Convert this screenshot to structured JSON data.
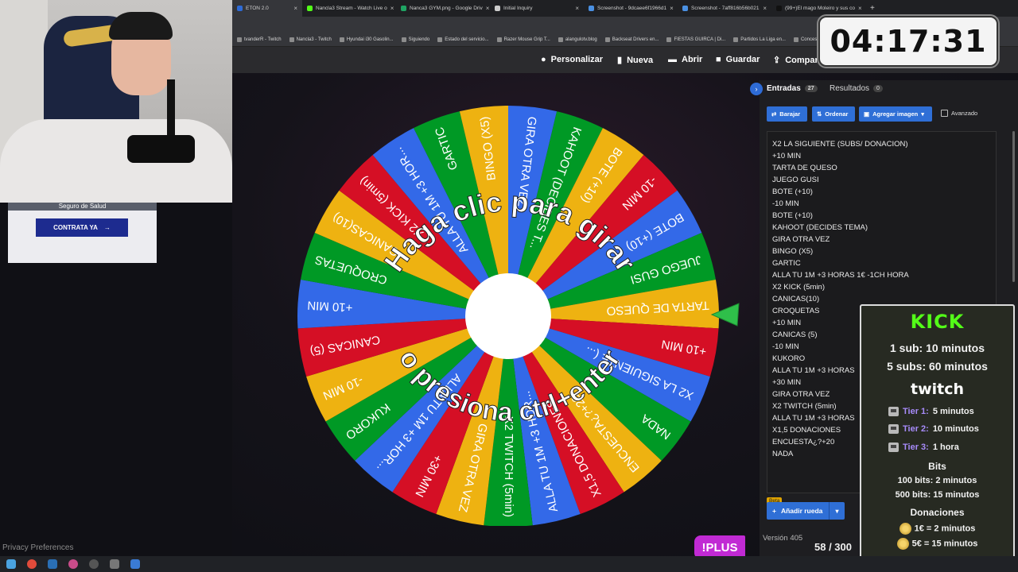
{
  "browser": {
    "tabs": [
      {
        "title": "ETON 2.0",
        "icon_color": "#2e6bd6",
        "active": true
      },
      {
        "title": "Nancla3 Stream - Watch Live o",
        "icon_color": "#53fc18",
        "active": false
      },
      {
        "title": "Nanca3 GYM.png - Google Driv",
        "icon_color": "#1fa463",
        "active": false
      },
      {
        "title": "Initial Inquiry",
        "icon_color": "#cccccc",
        "active": false
      },
      {
        "title": "Screenshot - 9dcaee6f1966d1",
        "icon_color": "#4a90e2",
        "active": false
      },
      {
        "title": "Screenshot - 7aff816b56b021",
        "icon_color": "#4a90e2",
        "active": false
      },
      {
        "title": "(99+)El mago Moleiro y sus co",
        "icon_color": "#111111",
        "active": false
      }
    ],
    "new_tab_symbol": "+",
    "bookmarks": [
      "tvanderR - Twitch",
      "Nancla3 - Twitch",
      "Hyundai i30 Gasolin...",
      "Siguiendo",
      "Estado del servicio...",
      "Razer Mouse Grip T...",
      "alangulotv.blog",
      "Backseat Drivers en...",
      "FIESTAS GUIRCA | Di...",
      "Partidos La Liga en...",
      "Concesion"
    ]
  },
  "left": {
    "ad_text": "Seguro de Salud",
    "ad_button": "CONTRATA YA",
    "ad_arrow": "→",
    "privacy": "Privacy Preferences"
  },
  "header": {
    "customize": "Personalizar",
    "new": "Nueva",
    "open": "Abrir",
    "save": "Guardar",
    "share": "Compar"
  },
  "wheel": {
    "segments": [
      "GIRA OTRA VEZ",
      "KAHOOT (DECIDES T...",
      "BOTE (+10)",
      "-10 MIN",
      "BOTE (+10)",
      "JUEGO GUSI",
      "TARTA DE QUESO",
      "+10 MIN",
      "X2 LA SIGUIENTE (...",
      "NADA",
      "ENCUESTA¿?+20",
      "X1,5 DONACIONES",
      "ALLA TU 1M +3 HOR...",
      "X2 TWITCH (5min)",
      "GIRA OTRA VEZ",
      "+30 MIN",
      "ALLA TU 1M +3 HOR...",
      "KUKORO",
      "-10 MIN",
      "CANICAS (5)",
      "+10 MIN",
      "CROQUETAS",
      "CANICAS(10)",
      "X2 KICK (5min)",
      "ALLA TU 1M +3 HOR...",
      "GARTIC",
      "BINGO (X5)"
    ],
    "colors": [
      "#3369e8",
      "#009925",
      "#eeb211",
      "#d50f25"
    ],
    "prompt_top": "Haga clic para girar",
    "prompt_bottom": "o presiona ctrl+enter"
  },
  "panel": {
    "tab_entries": "Entradas",
    "entries_count": "27",
    "tab_results": "Resultados",
    "results_count": "0",
    "shuffle": "Barajar",
    "sort": "Ordenar",
    "add_image": "Agregar imagen",
    "advanced": "Avanzado",
    "entries": [
      "X2 LA SIGUIENTE (SUBS/ DONACION)",
      "+10 MIN",
      "TARTA DE QUESO",
      "JUEGO GUSI",
      "BOTE (+10)",
      "-10 MIN",
      "BOTE (+10)",
      "KAHOOT (DECIDES TEMA)",
      "GIRA OTRA VEZ",
      "BINGO (X5)",
      "GARTIC",
      "ALLA TU 1M +3 HORAS 1€ -1CH HORA",
      "X2 KICK (5min)",
      "CANICAS(10)",
      "CROQUETAS",
      "+10 MIN",
      "CANICAS (5)",
      "-10 MIN",
      "KUKORO",
      "ALLA TU 1M +3 HORAS",
      "+30 MIN",
      "GIRA OTRA VEZ",
      "X2 TWITCH (5min)",
      "ALLA TU 1M +3 HORAS",
      "X1,5 DONACIONES",
      "ENCUESTA¿?+20",
      "NADA"
    ],
    "beta": "Beta",
    "add_wheel": "Añadir rueda",
    "version": "Versión 405"
  },
  "overlay": {
    "plus": "!PLUS",
    "counter": "58 / 300",
    "timer": "04:17:31",
    "kick_logo": "KICK",
    "kick_sub1": "1 sub: 10 minutos",
    "kick_sub5": "5 subs: 60 minutos",
    "twitch_logo": "twitch",
    "tier1_name": "Tier 1:",
    "tier1_value": "5 minutos",
    "tier2_name": "Tier 2:",
    "tier2_value": "10 minutos",
    "tier3_name": "Tier 3:",
    "tier3_value": "1 hora",
    "bits_title": "Bits",
    "bits_100": "100 bits: 2 minutos",
    "bits_500": "500 bits: 15 minutos",
    "donations_title": "Donaciones",
    "don_1": "1€ = 2 minutos",
    "don_5": "5€ = 15 minutos"
  }
}
